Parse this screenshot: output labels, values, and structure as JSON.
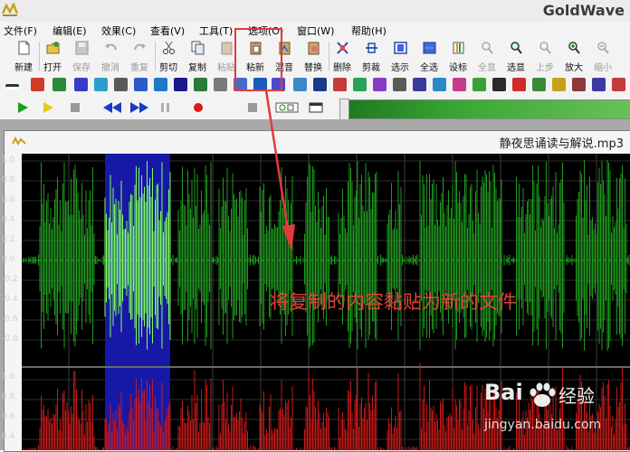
{
  "app": {
    "title": "GoldWave"
  },
  "menu": [
    "文件(F)",
    "编辑(E)",
    "效果(C)",
    "查看(V)",
    "工具(T)",
    "选项(O)",
    "窗口(W)",
    "帮助(H)"
  ],
  "toolbar": [
    {
      "label": "新建",
      "icon": "new-file-icon",
      "enabled": true
    },
    {
      "label": "打开",
      "icon": "open-folder-icon",
      "enabled": true
    },
    {
      "label": "保存",
      "icon": "save-icon",
      "enabled": false
    },
    {
      "label": "撤消",
      "icon": "undo-icon",
      "enabled": false
    },
    {
      "label": "重复",
      "icon": "redo-icon",
      "enabled": false
    },
    {
      "label": "剪切",
      "icon": "cut-icon",
      "enabled": true
    },
    {
      "label": "复制",
      "icon": "copy-icon",
      "enabled": true
    },
    {
      "label": "粘贴",
      "icon": "paste-icon",
      "enabled": false
    },
    {
      "label": "粘新",
      "icon": "paste-new-icon",
      "enabled": true
    },
    {
      "label": "混音",
      "icon": "mix-icon",
      "enabled": true
    },
    {
      "label": "替换",
      "icon": "replace-icon",
      "enabled": true
    },
    {
      "label": "删除",
      "icon": "delete-icon",
      "enabled": true
    },
    {
      "label": "剪裁",
      "icon": "trim-icon",
      "enabled": true
    },
    {
      "label": "选示",
      "icon": "show-selection-icon",
      "enabled": true
    },
    {
      "label": "全选",
      "icon": "select-all-icon",
      "enabled": true
    },
    {
      "label": "设标",
      "icon": "set-marker-icon",
      "enabled": true
    },
    {
      "label": "全显",
      "icon": "show-all-icon",
      "enabled": false
    },
    {
      "label": "选显",
      "icon": "zoom-selection-icon",
      "enabled": true
    },
    {
      "label": "上步",
      "icon": "previous-view-icon",
      "enabled": false
    },
    {
      "label": "放大",
      "icon": "zoom-in-icon",
      "enabled": true
    },
    {
      "label": "缩小",
      "icon": "zoom-out-icon",
      "enabled": false
    }
  ],
  "document": {
    "filename": "静夜思诵读与解说.mp3",
    "y_ticks_top": [
      "1.0",
      "0.8",
      "0.6",
      "0.4",
      "0.2",
      "0.0",
      "-0.2",
      "-0.4",
      "-0.6",
      "-0.8"
    ],
    "y_ticks_bottom": [
      "1.0",
      "0.8",
      "0.6",
      "0.4"
    ]
  },
  "annotation": {
    "text": "将复制的内容黏贴为新的文件"
  },
  "watermark": {
    "brand": "Bai",
    "suffix": "经验",
    "url": "jingyan.baidu.com"
  },
  "colors": {
    "annotation": "#e0433a",
    "selection": "#1818a8",
    "wave_left": "#1f9a1f",
    "wave_left_selected": "#7dff5a",
    "wave_right": "#c81818",
    "highlight": "#e23a3a"
  }
}
